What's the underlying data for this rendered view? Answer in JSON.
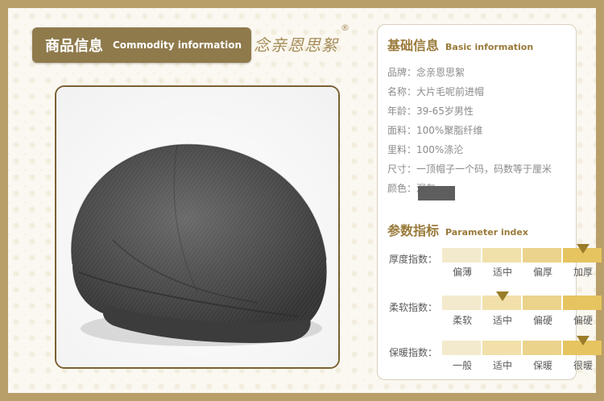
{
  "header": {
    "title_cn": "商品信息",
    "title_en": "Commodity information",
    "brand": "念亲恩思絮",
    "registered": "®"
  },
  "basic_info": {
    "title_cn": "基础信息",
    "title_en": "Basic information",
    "rows": [
      {
        "key": "品牌：",
        "value": "念亲恩思絮"
      },
      {
        "key": "名称：",
        "value": "大片毛呢前进帽"
      },
      {
        "key": "年龄：",
        "value": "39-65岁男性"
      },
      {
        "key": "面料：",
        "value": "100%聚脂纤维"
      },
      {
        "key": "里料：",
        "value": "100%涤沦"
      },
      {
        "key": "尺寸：",
        "value": "一顶帽子一个码，码数等于厘米"
      },
      {
        "key": "颜色：",
        "value": "深灰"
      }
    ],
    "color_swatch": "#5e5e5e"
  },
  "parameters": {
    "title_cn": "参数指标",
    "title_en": "Parameter index",
    "items": [
      {
        "label": "厚度指数：",
        "scale": [
          "偏薄",
          "适中",
          "偏厚",
          "加厚"
        ],
        "level": 3
      },
      {
        "label": "柔软指数：",
        "scale": [
          "柔软",
          "适中",
          "偏硬",
          "偏硬"
        ],
        "level": 1
      },
      {
        "label": "保暖指数：",
        "scale": [
          "一般",
          "适中",
          "保暖",
          "很暖"
        ],
        "level": 3
      }
    ]
  },
  "colors": {
    "accent": "#8f7a4c",
    "title": "#9a7a3a",
    "marker": "#9a7c2a"
  }
}
